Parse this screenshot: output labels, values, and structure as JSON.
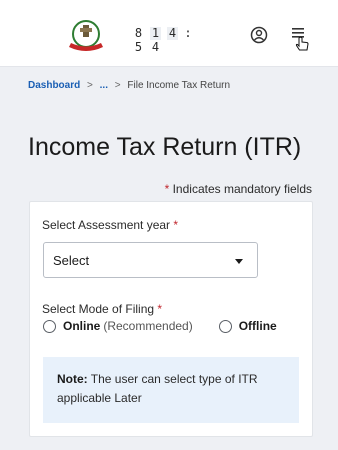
{
  "header": {
    "timer": {
      "row1": [
        "8",
        "1",
        "4",
        ":"
      ],
      "row2": [
        "5",
        "4"
      ]
    }
  },
  "breadcrumb": {
    "dashboard": "Dashboard",
    "sep1": ">",
    "ellipsis": "...",
    "sep2": ">",
    "current": "File Income Tax Return"
  },
  "page": {
    "title": "Income Tax Return (ITR)",
    "mandatory_star": "*",
    "mandatory_text": "Indicates mandatory fields"
  },
  "form": {
    "assessment_label": "Select Assessment year",
    "assessment_star": "*",
    "assessment_value": "Select",
    "mode_label": "Select Mode of Filing",
    "mode_star": "*",
    "online_label": "Online",
    "online_hint": "(Recommended)",
    "offline_label": "Offline",
    "note_prefix": "Note:",
    "note_text": "The user can select type of ITR applicable Later"
  },
  "colors": {
    "link": "#1a5fb4",
    "required": "#c0262d",
    "note_bg": "#e8f1fb"
  },
  "icons": [
    "emblem-logo",
    "user-icon",
    "menu-icon",
    "cursor-hand-icon",
    "dropdown-caret-icon"
  ]
}
